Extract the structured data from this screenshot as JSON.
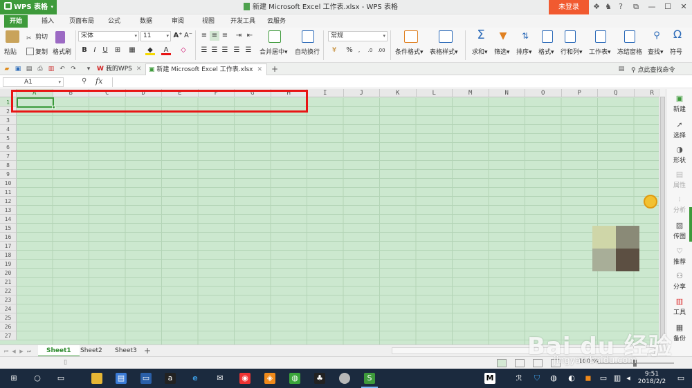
{
  "app": {
    "logo_label": "WPS 表格",
    "window_title": "新建 Microsoft Excel 工作表.xlsx - WPS 表格",
    "login_label": "未登录"
  },
  "menu": {
    "tabs": [
      "开始",
      "插入",
      "页面布局",
      "公式",
      "数据",
      "审阅",
      "视图",
      "开发工具",
      "云服务"
    ],
    "active": "开始"
  },
  "ribbon": {
    "paste": "粘贴",
    "cut": "剪切",
    "copy": "复制",
    "format_painter": "格式刷",
    "font_name": "宋体",
    "font_size": "11",
    "merge_center": "合并居中",
    "wrap_text": "自动换行",
    "number_format": "常规",
    "conditional_format": "条件格式",
    "table_style": "表格样式",
    "sum": "求和",
    "filter": "筛选",
    "sort": "排序",
    "format": "格式",
    "row_col": "行和列",
    "worksheet": "工作表",
    "freeze_panes": "冻结窗格",
    "find": "查找",
    "symbol": "符号",
    "bold": "B",
    "italic": "I",
    "underline": "U",
    "font_color": "A",
    "percent": "%"
  },
  "doc_tabs": {
    "home_tab": "我的WPS",
    "active_tab": "新建 Microsoft Excel 工作表.xlsx",
    "find_command": "点此查找命令"
  },
  "formula_bar": {
    "cell_ref": "A1",
    "fx_label": "fx",
    "formula": ""
  },
  "grid": {
    "columns": [
      "A",
      "B",
      "C",
      "D",
      "E",
      "F",
      "G",
      "H",
      "I",
      "J",
      "K",
      "L",
      "M",
      "N",
      "O",
      "P",
      "Q",
      "R"
    ],
    "rows": [
      "1",
      "2",
      "3",
      "4",
      "5",
      "6",
      "7",
      "8",
      "9",
      "10",
      "11",
      "12",
      "13",
      "14",
      "15",
      "16",
      "17",
      "18",
      "19",
      "20",
      "21",
      "22",
      "23",
      "24",
      "25",
      "26",
      "27"
    ],
    "selected_cell": "A1",
    "highlight_color": "#e81414",
    "grid_bg": "#cce8cf"
  },
  "sheets": {
    "tabs": [
      "Sheet1",
      "Sheet2",
      "Sheet3"
    ],
    "active": "Sheet1",
    "add_label": "+"
  },
  "status": {
    "zoom": "100 %"
  },
  "right_panel": {
    "items": [
      {
        "label": "新建",
        "icon": "new-icon"
      },
      {
        "label": "选择",
        "icon": "select-icon"
      },
      {
        "label": "形状",
        "icon": "shape-icon"
      },
      {
        "label": "属性",
        "icon": "properties-icon"
      },
      {
        "label": "分析",
        "icon": "analysis-icon"
      },
      {
        "label": "传图",
        "icon": "upload-image-icon"
      },
      {
        "label": "推荐",
        "icon": "recommend-icon"
      },
      {
        "label": "分享",
        "icon": "share-icon"
      },
      {
        "label": "工具",
        "icon": "tools-icon"
      },
      {
        "label": "备份",
        "icon": "backup-icon"
      }
    ]
  },
  "watermark": {
    "brand": "Bai du 经验",
    "url": "jingyan.baidu.com"
  },
  "taskbar": {
    "time": "9:51",
    "date": "2018/2/2"
  }
}
